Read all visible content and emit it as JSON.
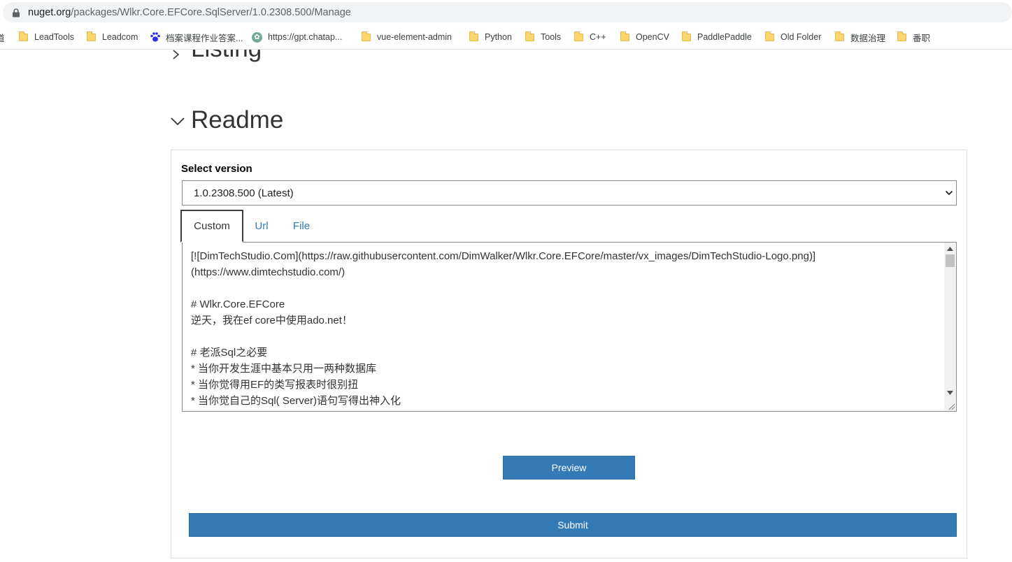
{
  "browser": {
    "url_host": "nuget.org",
    "url_path": "/packages/Wlkr.Core.EFCore.SqlServer/1.0.2308.500/Manage"
  },
  "bookmarks": {
    "cut_label": "道",
    "items": [
      {
        "label": "LeadTools",
        "icon": "folder-icon"
      },
      {
        "label": "Leadcom",
        "icon": "folder-icon"
      },
      {
        "label": "档案课程作业答案...",
        "icon": "paw-icon"
      },
      {
        "label": "https://gpt.chatap...",
        "icon": "gpt-icon"
      },
      {
        "label": "vue-element-admin",
        "icon": "folder-icon"
      },
      {
        "label": "Python",
        "icon": "folder-icon"
      },
      {
        "label": "Tools",
        "icon": "folder-icon"
      },
      {
        "label": "C++",
        "icon": "folder-icon"
      },
      {
        "label": "OpenCV",
        "icon": "folder-icon"
      },
      {
        "label": "PaddlePaddle",
        "icon": "folder-icon"
      },
      {
        "label": "Old Folder",
        "icon": "folder-icon"
      },
      {
        "label": "数据治理",
        "icon": "folder-icon"
      },
      {
        "label": "番职",
        "icon": "folder-icon"
      }
    ]
  },
  "page": {
    "listing_heading": "Listing",
    "readme_heading": "Readme",
    "select_version_label": "Select version",
    "selected_version": "1.0.2308.500 (Latest)",
    "tabs": {
      "custom": "Custom",
      "url": "Url",
      "file": "File"
    },
    "readme_text": "[![DimTechStudio.Com](https://raw.githubusercontent.com/DimWalker/Wlkr.Core.EFCore/master/vx_images/DimTechStudio-Logo.png)]\n(https://www.dimtechstudio.com/)\n\n# Wlkr.Core.EFCore\n逆天，我在ef core中使用ado.net！\n\n# 老派Sql之必要\n* 当你开发生涯中基本只用一两种数据库\n* 当你觉得用EF的类写报表时很别扭\n* 当你觉自己的Sql( Server)语句写得出神入化\n* 当你觉自己的Linq to Sql语句的一些时候不优化",
    "preview_label": "Preview",
    "submit_label": "Submit"
  }
}
